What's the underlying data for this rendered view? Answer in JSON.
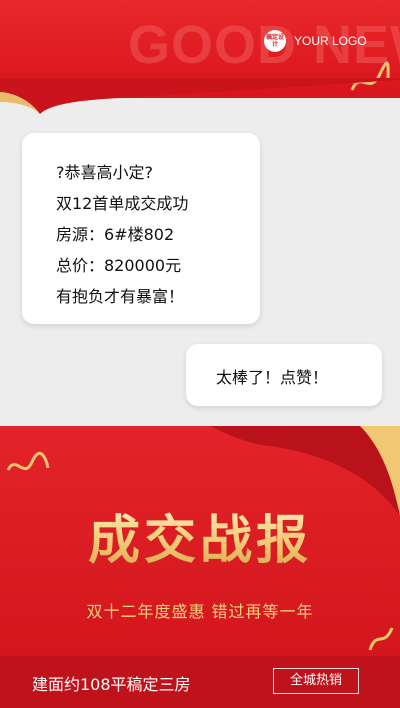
{
  "header": {
    "background_text": "GOOD NEWS",
    "logo_mark": "稿定设计",
    "logo_text": "YOUR LOGO"
  },
  "message_1": {
    "lines": [
      "?恭喜高小定?",
      "双12首单成交成功",
      "房源：6#楼802",
      "总价：820000元",
      "有抱负才有暴富！"
    ]
  },
  "message_2": {
    "text": "太棒了！点赞！"
  },
  "poster": {
    "headline": "成交战报",
    "subtitle": "双十二年度盛惠 错过再等一年",
    "footer_text": "建面约108平稿定三房",
    "footer_tag": "全城热销"
  },
  "colors": {
    "brand_red": "#e01f26",
    "gold": "#f3cc7a",
    "background": "#ededee"
  },
  "icons": [
    "gold-ribbon-icon",
    "page-curl-icon"
  ]
}
